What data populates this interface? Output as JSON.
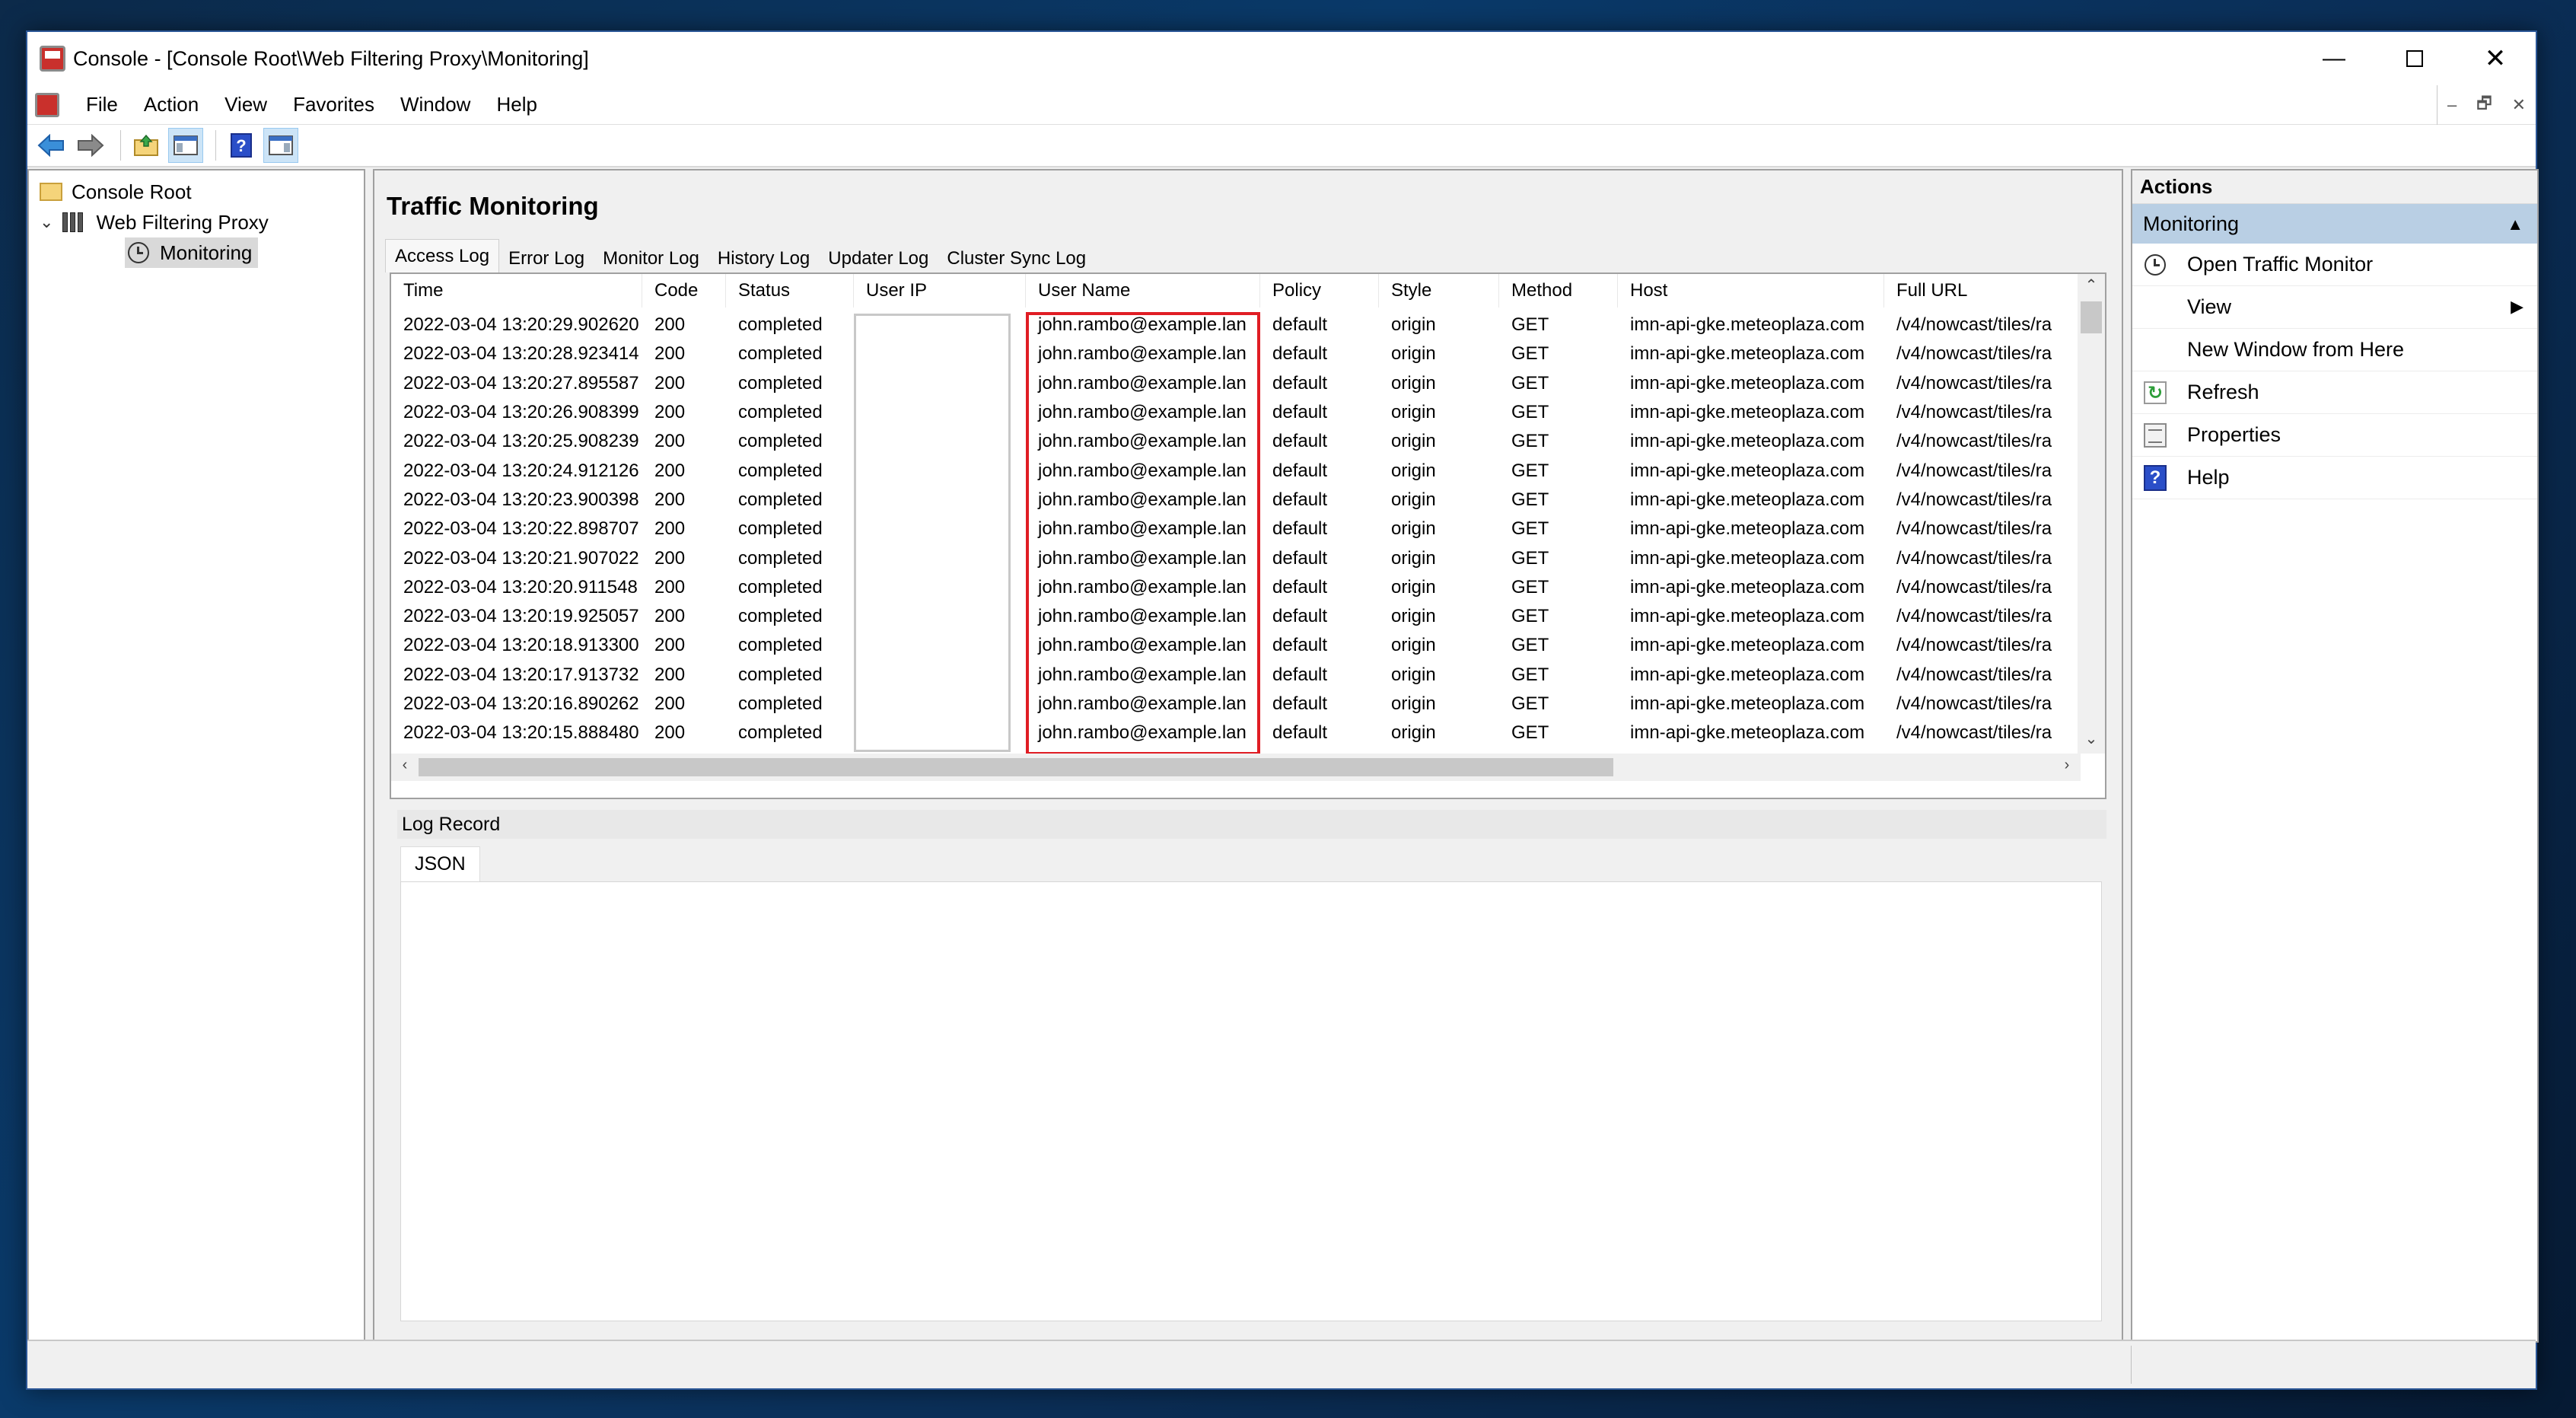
{
  "window": {
    "title": "Console - [Console Root\\Web Filtering Proxy\\Monitoring]",
    "minimize_glyph": "—",
    "close_glyph": "✕"
  },
  "menu": [
    "File",
    "Action",
    "View",
    "Favorites",
    "Window",
    "Help"
  ],
  "mdi_controls": [
    "‒",
    "🗗",
    "✕"
  ],
  "toolbar": {
    "icons": [
      "back-arrow-icon",
      "forward-arrow-icon",
      "up-folder-icon",
      "show-hide-console-tree-icon",
      "help-icon",
      "show-hide-action-pane-icon"
    ]
  },
  "tree": {
    "root": "Console Root",
    "proxy": "Web Filtering Proxy",
    "monitoring": "Monitoring"
  },
  "main": {
    "title": "Traffic Monitoring",
    "tabs": [
      "Access Log",
      "Error Log",
      "Monitor Log",
      "History Log",
      "Updater Log",
      "Cluster Sync Log"
    ],
    "active_tab": "Access Log",
    "columns": [
      "Time",
      "Code",
      "Status",
      "User IP",
      "User Name",
      "Policy",
      "Style",
      "Method",
      "Host",
      "Full URL"
    ],
    "rows": [
      [
        "2022-03-04 13:20:29.902620",
        "200",
        "completed",
        "",
        "john.rambo@example.lan",
        "default",
        "origin",
        "GET",
        "imn-api-gke.meteoplaza.com",
        "/v4/nowcast/tiles/ra"
      ],
      [
        "2022-03-04 13:20:28.923414",
        "200",
        "completed",
        "",
        "john.rambo@example.lan",
        "default",
        "origin",
        "GET",
        "imn-api-gke.meteoplaza.com",
        "/v4/nowcast/tiles/ra"
      ],
      [
        "2022-03-04 13:20:27.895587",
        "200",
        "completed",
        "",
        "john.rambo@example.lan",
        "default",
        "origin",
        "GET",
        "imn-api-gke.meteoplaza.com",
        "/v4/nowcast/tiles/ra"
      ],
      [
        "2022-03-04 13:20:26.908399",
        "200",
        "completed",
        "",
        "john.rambo@example.lan",
        "default",
        "origin",
        "GET",
        "imn-api-gke.meteoplaza.com",
        "/v4/nowcast/tiles/ra"
      ],
      [
        "2022-03-04 13:20:25.908239",
        "200",
        "completed",
        "",
        "john.rambo@example.lan",
        "default",
        "origin",
        "GET",
        "imn-api-gke.meteoplaza.com",
        "/v4/nowcast/tiles/ra"
      ],
      [
        "2022-03-04 13:20:24.912126",
        "200",
        "completed",
        "",
        "john.rambo@example.lan",
        "default",
        "origin",
        "GET",
        "imn-api-gke.meteoplaza.com",
        "/v4/nowcast/tiles/ra"
      ],
      [
        "2022-03-04 13:20:23.900398",
        "200",
        "completed",
        "",
        "john.rambo@example.lan",
        "default",
        "origin",
        "GET",
        "imn-api-gke.meteoplaza.com",
        "/v4/nowcast/tiles/ra"
      ],
      [
        "2022-03-04 13:20:22.898707",
        "200",
        "completed",
        "",
        "john.rambo@example.lan",
        "default",
        "origin",
        "GET",
        "imn-api-gke.meteoplaza.com",
        "/v4/nowcast/tiles/ra"
      ],
      [
        "2022-03-04 13:20:21.907022",
        "200",
        "completed",
        "",
        "john.rambo@example.lan",
        "default",
        "origin",
        "GET",
        "imn-api-gke.meteoplaza.com",
        "/v4/nowcast/tiles/ra"
      ],
      [
        "2022-03-04 13:20:20.911548",
        "200",
        "completed",
        "",
        "john.rambo@example.lan",
        "default",
        "origin",
        "GET",
        "imn-api-gke.meteoplaza.com",
        "/v4/nowcast/tiles/ra"
      ],
      [
        "2022-03-04 13:20:19.925057",
        "200",
        "completed",
        "",
        "john.rambo@example.lan",
        "default",
        "origin",
        "GET",
        "imn-api-gke.meteoplaza.com",
        "/v4/nowcast/tiles/ra"
      ],
      [
        "2022-03-04 13:20:18.913300",
        "200",
        "completed",
        "",
        "john.rambo@example.lan",
        "default",
        "origin",
        "GET",
        "imn-api-gke.meteoplaza.com",
        "/v4/nowcast/tiles/ra"
      ],
      [
        "2022-03-04 13:20:17.913732",
        "200",
        "completed",
        "",
        "john.rambo@example.lan",
        "default",
        "origin",
        "GET",
        "imn-api-gke.meteoplaza.com",
        "/v4/nowcast/tiles/ra"
      ],
      [
        "2022-03-04 13:20:16.890262",
        "200",
        "completed",
        "",
        "john.rambo@example.lan",
        "default",
        "origin",
        "GET",
        "imn-api-gke.meteoplaza.com",
        "/v4/nowcast/tiles/ra"
      ],
      [
        "2022-03-04 13:20:15.888480",
        "200",
        "completed",
        "",
        "john.rambo@example.lan",
        "default",
        "origin",
        "GET",
        "imn-api-gke.meteoplaza.com",
        "/v4/nowcast/tiles/ra"
      ]
    ],
    "log_record_label": "Log Record",
    "json_tab": "JSON"
  },
  "actions": {
    "header": "Actions",
    "section": "Monitoring",
    "items": [
      {
        "label": "Open Traffic Monitor",
        "icon": "clock-icon"
      },
      {
        "label": "View",
        "icon": "",
        "submenu": true
      },
      {
        "label": "New Window from Here",
        "icon": ""
      },
      {
        "label": "Refresh",
        "icon": "refresh-icon"
      },
      {
        "label": "Properties",
        "icon": "properties-icon"
      },
      {
        "label": "Help",
        "icon": "help-icon"
      }
    ]
  },
  "colors": {
    "highlight_border": "#e01d24",
    "actions_section_bg": "#b9cfe4",
    "selection_bg": "#cce4f7"
  }
}
